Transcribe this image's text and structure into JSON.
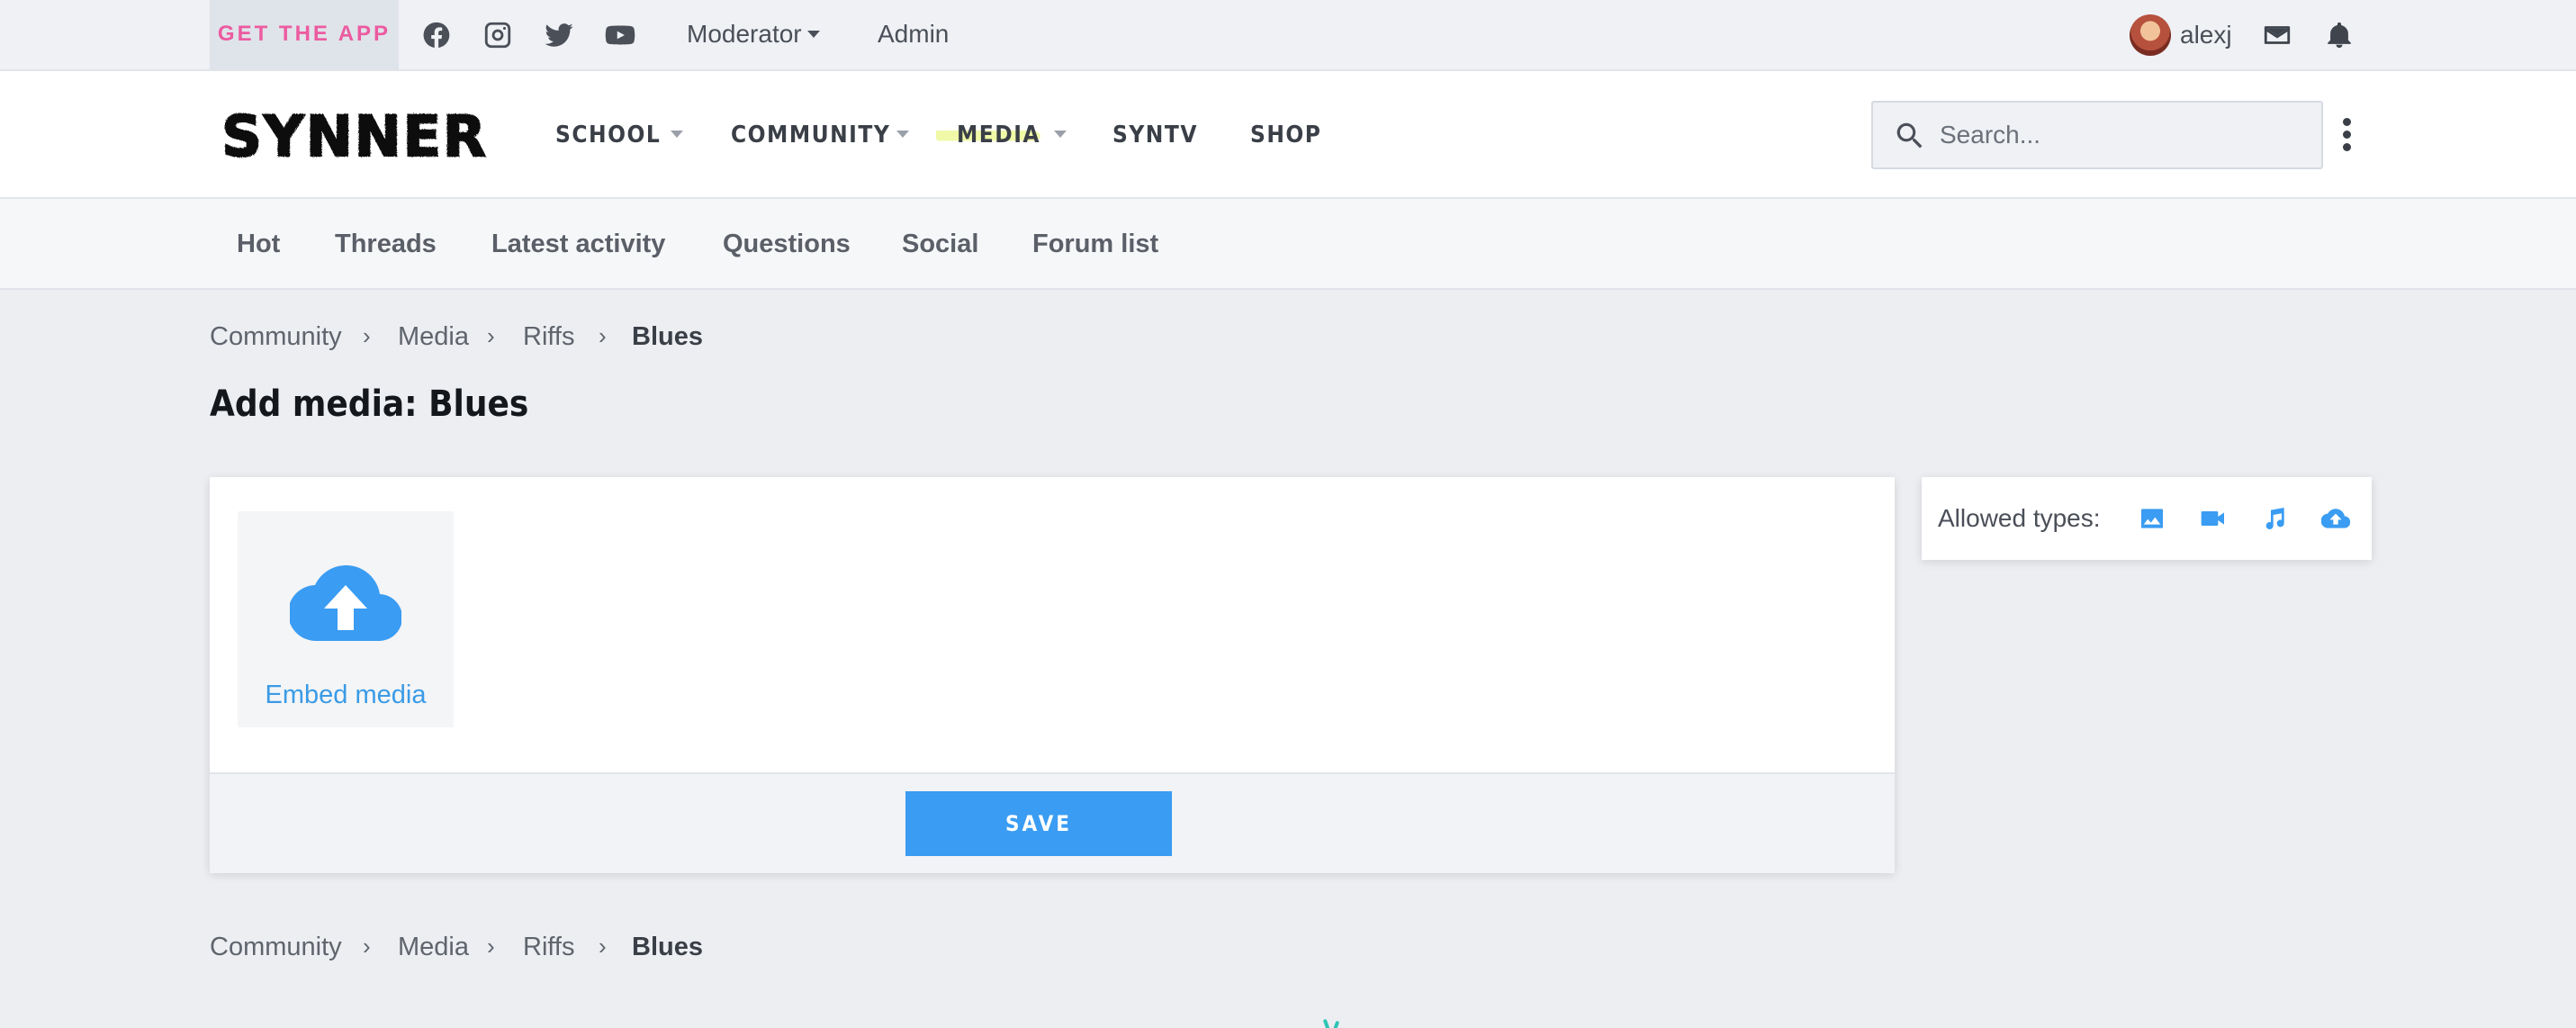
{
  "topbar": {
    "get_app": "GET THE APP",
    "social_icons": [
      "facebook-icon",
      "instagram-icon",
      "twitter-icon",
      "youtube-icon"
    ],
    "moderator": "Moderator",
    "admin": "Admin",
    "username": "alexj",
    "accent_color": "#ec5ba0"
  },
  "header": {
    "logo_text": "SYNNER",
    "nav": [
      {
        "label": "SCHOOL",
        "has_menu": true
      },
      {
        "label": "COMMUNITY",
        "has_menu": true
      },
      {
        "label": "MEDIA",
        "has_menu": true
      },
      {
        "label": "SYNTV",
        "has_menu": false
      },
      {
        "label": "SHOP",
        "has_menu": false
      }
    ],
    "search_placeholder": "Search..."
  },
  "subnav": [
    "Hot",
    "Threads",
    "Latest activity",
    "Questions",
    "Social",
    "Forum list"
  ],
  "breadcrumbs": [
    "Community",
    "Media",
    "Riffs",
    "Blues"
  ],
  "page_title": "Add media: Blues",
  "upload": {
    "embed_label": "Embed media",
    "save_label": "SAVE",
    "button_color": "#3a9cf2"
  },
  "allowed": {
    "label": "Allowed types:",
    "types": [
      "image-icon",
      "video-icon",
      "audio-icon",
      "embed-upload-icon"
    ]
  }
}
